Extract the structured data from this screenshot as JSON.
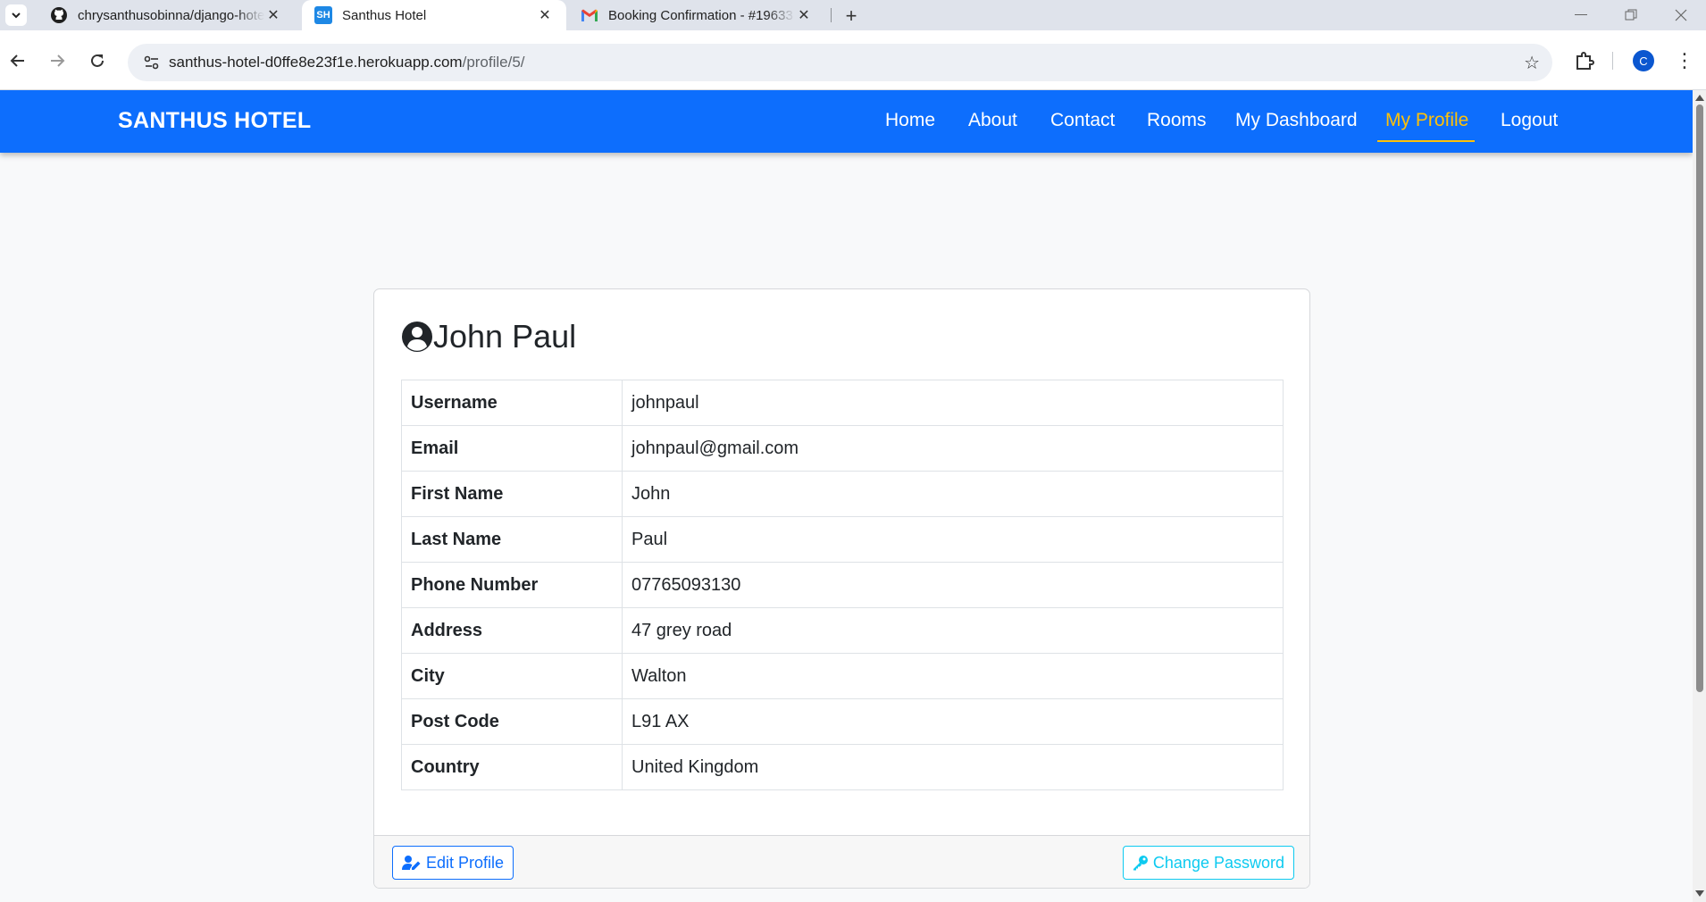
{
  "browser": {
    "tabs": [
      {
        "title": "chrysanthusobinna/django-hotel",
        "active": false,
        "icon": "github-icon"
      },
      {
        "title": "Santhus Hotel",
        "active": true,
        "icon": "sh-favicon",
        "favicon_text": "SH"
      },
      {
        "title": "Booking Confirmation - #19633",
        "active": false,
        "icon": "gmail-icon"
      }
    ],
    "url_host": "santhus-hotel-d0ffe8e23f1e.herokuapp.com",
    "url_path": "/profile/5/",
    "profile_initial": "C"
  },
  "navbar": {
    "brand": "SANTHUS HOTEL",
    "links": [
      {
        "label": "Home",
        "active": false
      },
      {
        "label": "About",
        "active": false
      },
      {
        "label": "Contact",
        "active": false
      },
      {
        "label": "Rooms",
        "active": false
      },
      {
        "label": "My Dashboard",
        "active": false
      },
      {
        "label": "My Profile",
        "active": true
      },
      {
        "label": "Logout",
        "active": false
      }
    ],
    "colors": {
      "background": "#0d6efd",
      "active": "#ffc107"
    }
  },
  "profile": {
    "name": "John Paul",
    "rows": [
      {
        "label": "Username",
        "value": "johnpaul"
      },
      {
        "label": "Email",
        "value": "johnpaul@gmail.com"
      },
      {
        "label": "First Name",
        "value": "John"
      },
      {
        "label": "Last Name",
        "value": "Paul"
      },
      {
        "label": "Phone Number",
        "value": "07765093130"
      },
      {
        "label": "Address",
        "value": "47 grey road"
      },
      {
        "label": "City",
        "value": "Walton"
      },
      {
        "label": "Post Code",
        "value": "L91 AX"
      },
      {
        "label": "Country",
        "value": "United Kingdom"
      }
    ],
    "edit_label": "Edit Profile",
    "change_password_label": "Change Password"
  }
}
